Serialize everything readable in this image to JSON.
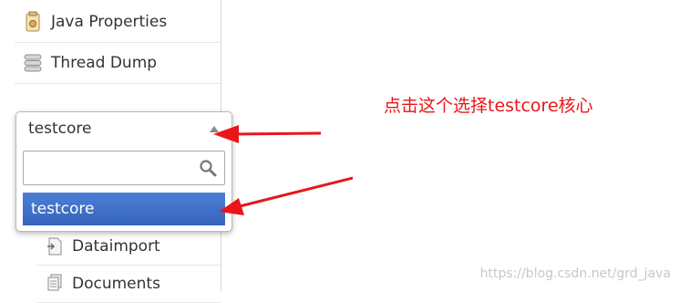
{
  "sidebar": {
    "items": [
      {
        "label": "Java Properties",
        "icon": "java-properties-icon"
      },
      {
        "label": "Thread Dump",
        "icon": "thread-dump-icon"
      }
    ],
    "core_selector": {
      "selected": "testcore",
      "search_placeholder": "",
      "search_value": "",
      "options": [
        "testcore"
      ]
    },
    "core_menu": [
      {
        "label": "Dataimport",
        "icon": "dataimport-icon"
      },
      {
        "label": "Documents",
        "icon": "documents-icon"
      }
    ]
  },
  "annotation": {
    "text": "点击这个选择testcore核心",
    "color": "#e8161b"
  },
  "watermark": {
    "text": "https://blog.csdn.net/grd_java"
  },
  "colors": {
    "selected_option": "#3764bd",
    "arrow": "#e8161b"
  }
}
